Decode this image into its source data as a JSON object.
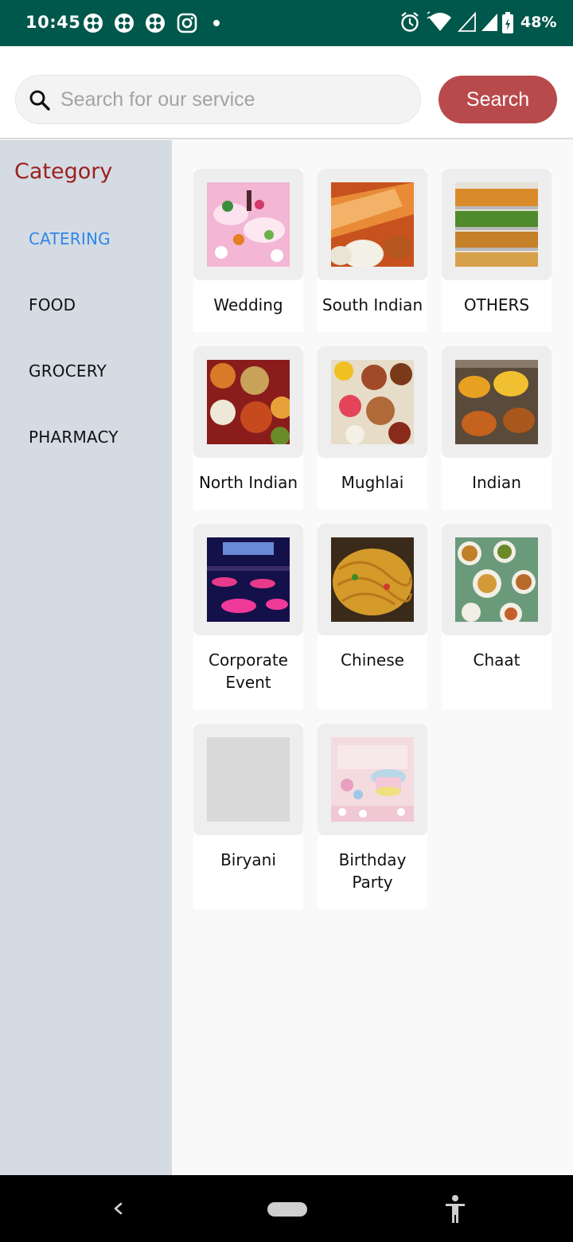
{
  "status_bar": {
    "time": "10:45",
    "battery": "48%",
    "icons": [
      "app-notification-icon",
      "app-notification-icon",
      "app-notification-icon",
      "instagram-icon",
      "dot-icon",
      "alarm-icon",
      "wifi-icon",
      "signal-icon",
      "signal-icon",
      "battery-icon"
    ]
  },
  "search": {
    "placeholder": "Search for our service",
    "value": "",
    "button_label": "Search"
  },
  "sidebar": {
    "title": "Category",
    "items": [
      {
        "label": "CATERING",
        "active": true
      },
      {
        "label": "FOOD",
        "active": false
      },
      {
        "label": "GROCERY",
        "active": false
      },
      {
        "label": "PHARMACY",
        "active": false
      }
    ]
  },
  "categories": [
    {
      "label": "Wedding"
    },
    {
      "label": "South Indian"
    },
    {
      "label": "OTHERS"
    },
    {
      "label": "North Indian"
    },
    {
      "label": "Mughlai"
    },
    {
      "label": "Indian"
    },
    {
      "label": "Corporate Event"
    },
    {
      "label": "Chinese"
    },
    {
      "label": "Chaat"
    },
    {
      "label": "Biryani"
    },
    {
      "label": "Birthday Party"
    }
  ],
  "colors": {
    "status_bar": "#00574b",
    "search_button": "#b94a4b",
    "sidebar_bg": "#d4dbe2",
    "sidebar_title": "#9c1f1f",
    "sidebar_active": "#2f86e8"
  }
}
